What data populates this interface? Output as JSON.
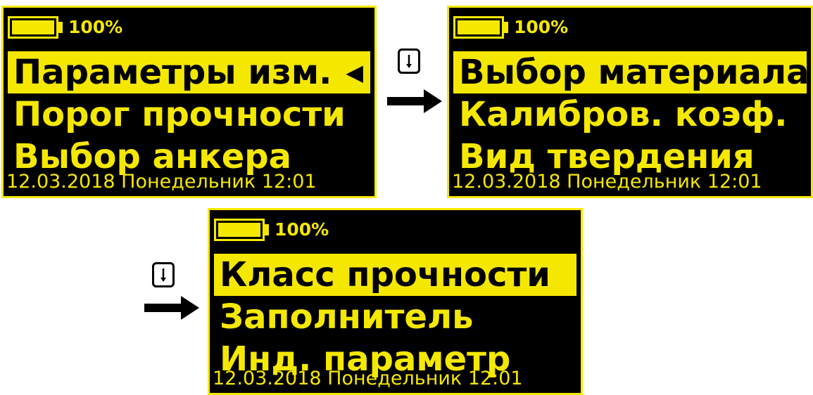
{
  "colors": {
    "accent": "#f5e800",
    "screen_bg": "#000000",
    "page_bg": "#ffffff"
  },
  "screens": [
    {
      "battery_level": 1.0,
      "battery_label": "100%",
      "items": [
        "Параметры изм.",
        "Порог прочности",
        "Выбор анкера"
      ],
      "selected_index": 0,
      "cursor": "◀",
      "footer": "12.03.2018  Понедельник  12:01"
    },
    {
      "battery_level": 1.0,
      "battery_label": "100%",
      "items": [
        "Выбор материала",
        "Калибров. коэф.",
        "Вид твердения"
      ],
      "selected_index": 0,
      "footer": "12.03.2018  Понедельник  12:01"
    },
    {
      "battery_level": 1.0,
      "battery_label": "100%",
      "items": [
        "Класс прочности",
        "Заполнитель",
        "Инд. параметр"
      ],
      "selected_index": 0,
      "footer": "12.03.2018  Понедельник  12:01"
    }
  ],
  "transitions": [
    {
      "key_icon": "arrow-down-key-icon"
    },
    {
      "key_icon": "arrow-down-key-icon"
    }
  ]
}
